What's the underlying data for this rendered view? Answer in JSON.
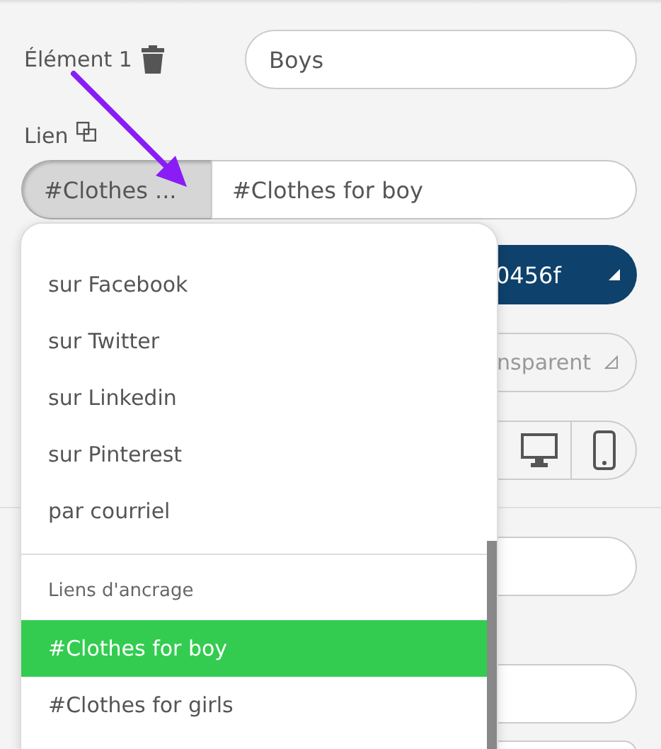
{
  "element": {
    "label": "Élément 1",
    "value": "Boys"
  },
  "link": {
    "label": "Lien",
    "selector": "#Clothes ...",
    "value": "#Clothes for boy"
  },
  "color_field": {
    "value": "0456f"
  },
  "background_field": {
    "value": "nsparent"
  },
  "devices": [
    {
      "kind": "desktop"
    },
    {
      "kind": "phone"
    }
  ],
  "menu": {
    "sections": [
      {
        "items": [
          {
            "label": "sur Facebook",
            "selected": false
          },
          {
            "label": "sur Twitter",
            "selected": false
          },
          {
            "label": "sur Linkedin",
            "selected": false
          },
          {
            "label": "sur Pinterest",
            "selected": false
          },
          {
            "label": "par courriel",
            "selected": false
          }
        ]
      },
      {
        "heading": "Liens d'ancrage",
        "items": [
          {
            "label": "#Clothes for boy",
            "selected": true
          },
          {
            "label": "#Clothes for girls",
            "selected": false
          }
        ]
      }
    ]
  }
}
